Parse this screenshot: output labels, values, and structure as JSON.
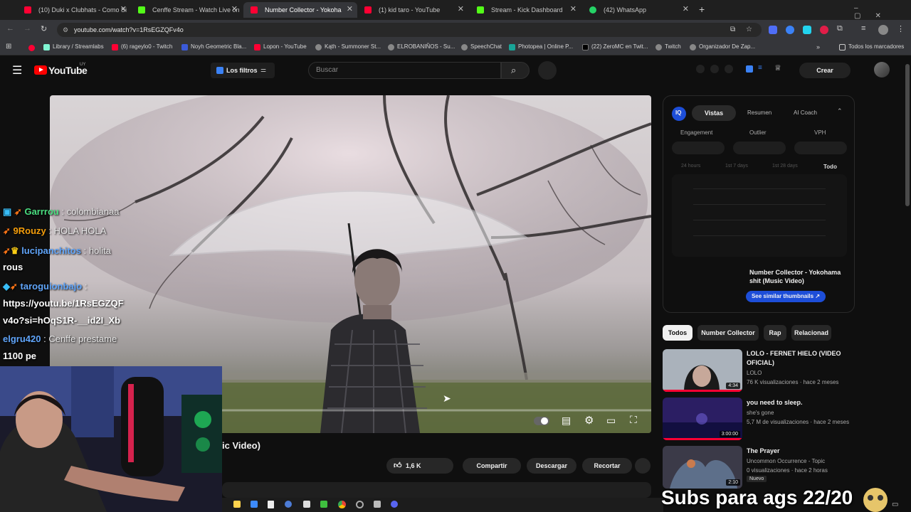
{
  "browser": {
    "tabs": [
      {
        "label": "(10) Duki x Clubhats - Como Si",
        "color": "#ff0033"
      },
      {
        "label": "Cenffe Stream - Watch Live on",
        "color": "#53fc18"
      },
      {
        "label": "Number Collector - Yokoha",
        "color": "#ff0033"
      },
      {
        "label": "(1) kid taro - YouTube",
        "color": "#ff0033"
      },
      {
        "label": "Stream - Kick Dashboard",
        "color": "#53fc18"
      },
      {
        "label": "(42) WhatsApp",
        "color": "#25d366"
      }
    ],
    "url": "youtube.com/watch?v=1RsEGZQFv4o",
    "bookmarks": [
      {
        "label": "Library / Streamlabs",
        "color": "#80f5d2"
      },
      {
        "label": "(6) rageylo0 - Twitch",
        "color": "#ff0033"
      },
      {
        "label": "Noyh Geometric Bla...",
        "color": "#3b5ad9"
      },
      {
        "label": "Lopon - YouTube",
        "color": "#ff0033"
      },
      {
        "label": "Kąth - Summoner St...",
        "color": "#888888"
      },
      {
        "label": "ELROBANIÑOS - Su...",
        "color": "#888888"
      },
      {
        "label": "SpeechChat",
        "color": "#888888"
      },
      {
        "label": "Photopea | Online P...",
        "color": "#18a497"
      },
      {
        "label": "(22) ZeroMC en Twit...",
        "color": "#000000"
      },
      {
        "label": "Twitch",
        "color": "#888888"
      },
      {
        "label": "Organizador De Zap...",
        "color": "#888888"
      }
    ],
    "all_bookmarks": "Todos los marcadores"
  },
  "youtube": {
    "logo": "YouTube",
    "region": "UY",
    "filters": "Los filtros",
    "search_placeholder": "Buscar",
    "create": "Crear",
    "title_fragment": "ic Video)",
    "likes": "1,6 K",
    "share": "Compartir",
    "download": "Descargar",
    "clip": "Recortar"
  },
  "extension_panel": {
    "tabs": [
      "Vistas",
      "Resumen",
      "AI Coach"
    ],
    "metrics": [
      "Engagement",
      "Outlier",
      "VPH"
    ],
    "ranges": [
      "24 hours",
      "1st 7 days",
      "1st 28 days",
      "Todo"
    ],
    "video_title": "Number Collector - Yokohama shit (Music Video)",
    "similar": "See similar thumbnails"
  },
  "chips": [
    "Todos",
    "Number Collector",
    "Rap",
    "Relacionad"
  ],
  "recommendations": [
    {
      "title": "LOLO - FERNET HIELO (VIDEO OFICIAL)",
      "channel": "LOLO",
      "meta": "76 K visualizaciones · hace 2 meses",
      "duration": "4:34"
    },
    {
      "title": "you need to sleep.",
      "channel": "she's gone",
      "meta": "5,7 M de visualizaciones · hace 2 meses",
      "duration": "3:00:00"
    },
    {
      "title": "The Prayer",
      "channel": "Uncommon Occurrence - Topic",
      "meta": "0 visualizaciones · hace 2 horas",
      "badge": "Nuevo",
      "duration": "2:10"
    }
  ],
  "chat": [
    {
      "user": "Garrrou",
      "msg": ": colombianaa",
      "color": "#4ade80"
    },
    {
      "user": "9Rouzy",
      "msg": ": HOLA HOLA",
      "color": "#f59e0b"
    },
    {
      "user": "lucipanchitos",
      "msg": ": holita",
      "color": "#60a5fa"
    },
    {
      "cont": "rous"
    },
    {
      "user": "taroguionbajo",
      "msg": ":",
      "color": "#60a5fa"
    },
    {
      "cont": "https://youtu.be/1RsEGZQF"
    },
    {
      "cont": "v4o?si=hOqS1R-__id2I_Xb"
    },
    {
      "user": "elgru420",
      "msg": ": Cenffe prestame",
      "color": "#60a5fa"
    },
    {
      "cont": "1100 pe"
    }
  ],
  "overlay_text": "Subs para ags 22/20"
}
